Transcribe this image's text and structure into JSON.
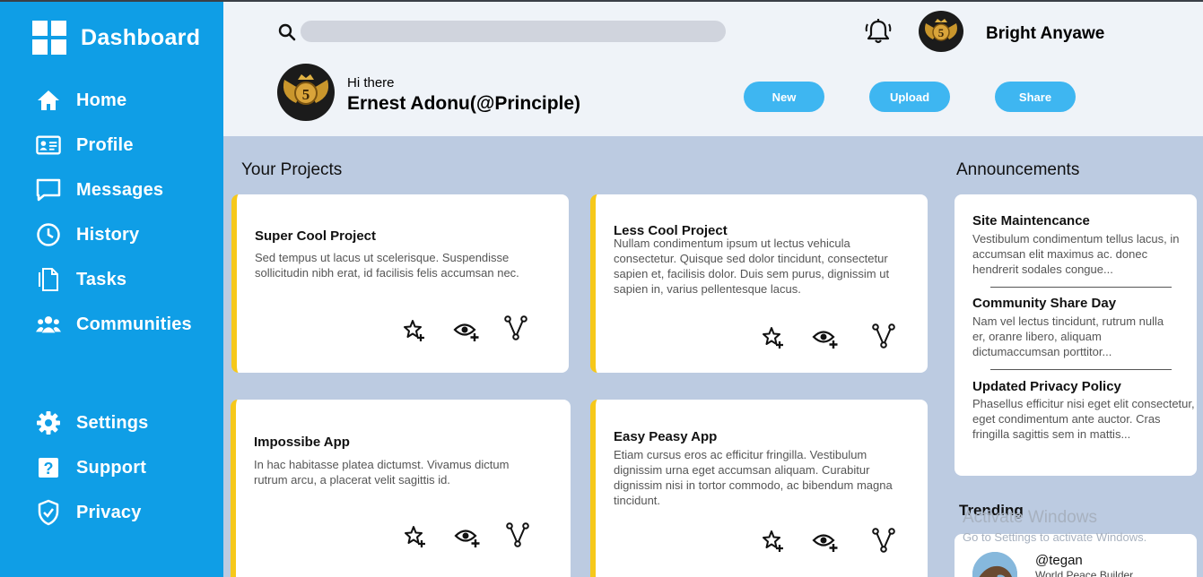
{
  "sidebar": {
    "title": "Dashboard",
    "items": [
      {
        "label": "Home",
        "icon": "home-icon"
      },
      {
        "label": "Profile",
        "icon": "profile-card-icon"
      },
      {
        "label": "Messages",
        "icon": "message-icon"
      },
      {
        "label": "History",
        "icon": "clock-icon"
      },
      {
        "label": "Tasks",
        "icon": "document-icon"
      },
      {
        "label": "Communities",
        "icon": "users-icon"
      }
    ],
    "bottom_items": [
      {
        "label": "Settings",
        "icon": "gear-icon"
      },
      {
        "label": "Support",
        "icon": "help-icon"
      },
      {
        "label": "Privacy",
        "icon": "shield-icon"
      }
    ]
  },
  "header": {
    "search_placeholder": "",
    "user_name": "Bright Anyawe",
    "greeting": "Hi there",
    "greeting_name": "Ernest Adonu(@Principle)",
    "buttons": {
      "new": "New",
      "upload": "Upload",
      "share": "Share"
    }
  },
  "projects": {
    "title": "Your Projects",
    "cards": [
      {
        "title": "Super Cool Project",
        "body": "Sed tempus ut lacus ut scelerisque. Suspendisse sollicitudin nibh erat, id facilisis felis accumsan nec."
      },
      {
        "title": "Less Cool Project",
        "body": "Nullam condimentum ipsum ut lectus vehicula consectetur. Quisque sed dolor tincidunt, consectetur sapien et, facilisis dolor. Duis sem purus, dignissim ut sapien in, varius pellentesque lacus."
      },
      {
        "title": "Impossibe App",
        "body": "In hac habitasse platea dictumst. Vivamus dictum rutrum arcu, a placerat velit sagittis id."
      },
      {
        "title": "Easy Peasy App",
        "body": "Etiam cursus eros ac efficitur fringilla. Vestibulum dignissim urna eget accumsan aliquam. Curabitur dignissim nisi in tortor commodo, ac bibendum magna tincidunt."
      }
    ]
  },
  "announcements": {
    "title": "Announcements",
    "items": [
      {
        "title": "Site Maintencance",
        "body": "Vestibulum condimentum tellus lacus, in accumsan elit maximus ac. donec hendrerit sodales congue..."
      },
      {
        "title": "Community Share Day",
        "body": "Nam vel lectus tincidunt, rutrum nulla er, oranre libero, aliquam dictumaccumsan porttitor..."
      },
      {
        "title": "Updated Privacy Policy",
        "body": "Phasellus efficitur nisi eget elit consectetur, eget condimentum ante auctor. Cras fringilla sagittis sem in mattis..."
      }
    ]
  },
  "trending": {
    "title": "Trending",
    "handle": "@tegan",
    "subtitle": "World Peace Builder"
  },
  "watermark": {
    "line1": "Activate Windows",
    "line2": "Go to Settings to activate Windows."
  },
  "colors": {
    "sidebar": "#0f9ee6",
    "header": "#eff3f8",
    "page": "#bccbe1",
    "accent_button": "#3eb6f1",
    "card_stripe": "#f6c81a"
  }
}
